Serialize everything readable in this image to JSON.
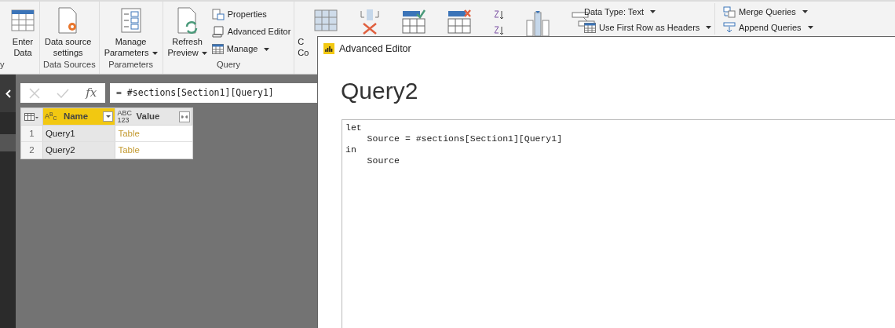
{
  "ribbon": {
    "cut_group_label": "y",
    "groups": [
      {
        "buttons": [
          {
            "kind": "big",
            "lines": [
              "Enter",
              "Data"
            ],
            "dropdown": false
          }
        ]
      },
      {
        "label": "Data Sources",
        "buttons": [
          {
            "kind": "big",
            "lines": [
              "Data source",
              "settings"
            ],
            "dropdown": false
          }
        ]
      },
      {
        "label": "Parameters",
        "buttons": [
          {
            "kind": "big",
            "lines": [
              "Manage",
              "Parameters"
            ],
            "dropdown": true
          }
        ]
      },
      {
        "label": "Query",
        "buttons": [
          {
            "kind": "big",
            "lines": [
              "Refresh",
              "Preview"
            ],
            "dropdown": true
          },
          {
            "kind": "stack",
            "items": [
              {
                "label": "Properties",
                "dropdown": false
              },
              {
                "label": "Advanced Editor",
                "dropdown": false
              },
              {
                "label": "Manage",
                "dropdown": true
              }
            ]
          }
        ]
      }
    ],
    "cut_button_lines": [
      "C",
      "Co"
    ],
    "right_items": [
      {
        "label": "Data Type: Text"
      },
      {
        "label": "Use First Row as Headers"
      }
    ],
    "combine_items": [
      {
        "label": "Merge Queries"
      },
      {
        "label": "Append Queries"
      }
    ]
  },
  "formula_bar": {
    "formula": "= #sections[Section1][Query1]",
    "fx": "fx"
  },
  "table": {
    "columns": [
      {
        "label": "Name",
        "type": [
          "A$^{B}$$_{C}$"
        ],
        "selected": true
      },
      {
        "label": "Value",
        "type": [
          "ABC",
          "123"
        ],
        "selected": false
      }
    ],
    "rows": [
      {
        "index": "1",
        "name": "Query1",
        "value": "Table"
      },
      {
        "index": "2",
        "name": "Query2",
        "value": "Table"
      }
    ]
  },
  "dialog": {
    "title": "Advanced Editor",
    "heading": "Query2",
    "code": [
      "let",
      "    Source = #sections[Section1][Query1]",
      "in",
      "    Source"
    ]
  }
}
